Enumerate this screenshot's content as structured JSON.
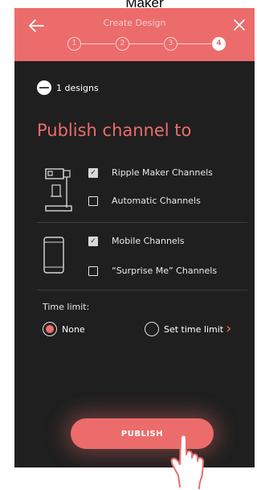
{
  "overlay": {
    "top_caption": "Maker"
  },
  "header": {
    "title": "Create Design",
    "steps": [
      "1",
      "2",
      "3",
      "4"
    ],
    "active_step": 4
  },
  "designs": {
    "count_text": "1 designs"
  },
  "publish": {
    "title": "Publish channel to",
    "groups": [
      {
        "icon": "ripple-maker-machine-icon",
        "options": [
          {
            "label": "Ripple Maker Channels",
            "checked": true
          },
          {
            "label": "Automatic Channels",
            "checked": false
          }
        ]
      },
      {
        "icon": "mobile-phone-icon",
        "options": [
          {
            "label": "Mobile Channels",
            "checked": true
          },
          {
            "label": "“Surprise Me” Channels",
            "checked": false
          }
        ]
      }
    ]
  },
  "time_limit": {
    "label": "Time limit:",
    "options": [
      {
        "label": "None",
        "selected": true
      },
      {
        "label": "Set time limit",
        "selected": false
      }
    ]
  },
  "publish_button": {
    "label": "PUBLISH"
  },
  "colors": {
    "accent": "#ec6c6c",
    "background": "#1f1f1f"
  }
}
